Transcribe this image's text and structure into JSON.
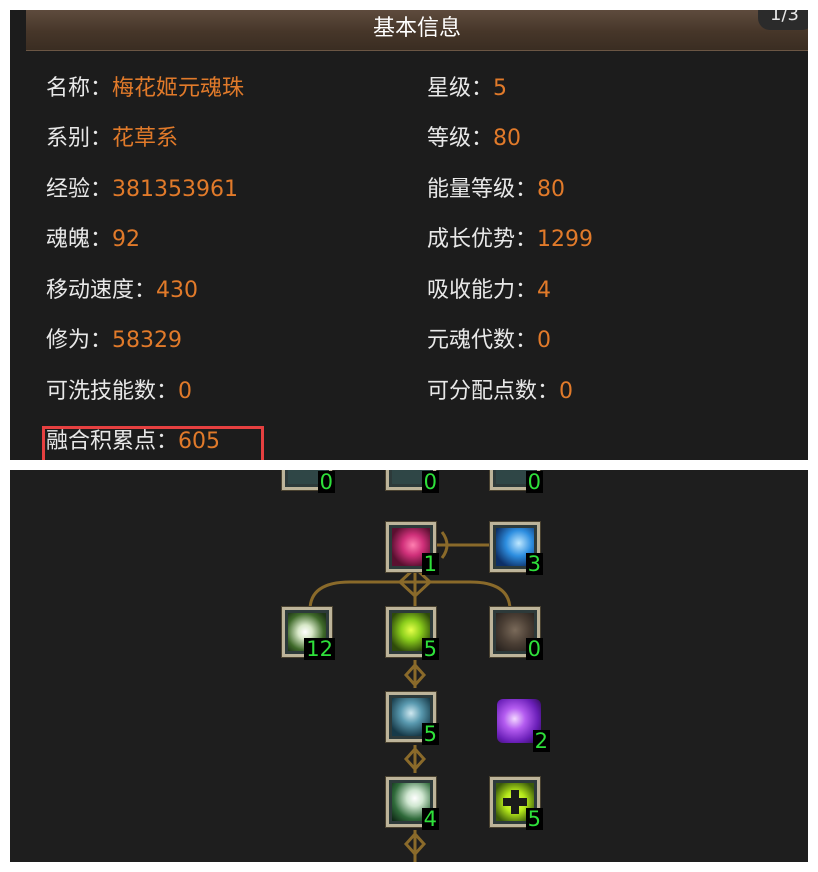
{
  "header": {
    "title": "基本信息",
    "page_indicator": "1/3"
  },
  "info": {
    "left": [
      {
        "label": "名称：",
        "value": "梅花姬元魂珠"
      },
      {
        "label": "系别：",
        "value": "花草系"
      },
      {
        "label": "经验：",
        "value": "381353961"
      },
      {
        "label": "魂魄：",
        "value": "92"
      },
      {
        "label": "移动速度：",
        "value": "430"
      },
      {
        "label": "修为：",
        "value": "58329"
      },
      {
        "label": "可洗技能数：",
        "value": "0"
      },
      {
        "label": "融合积累点：",
        "value": "605"
      }
    ],
    "right": [
      {
        "label": "星级：",
        "value": "5"
      },
      {
        "label": "等级：",
        "value": "80"
      },
      {
        "label": "能量等级：",
        "value": "80"
      },
      {
        "label": "成长优势：",
        "value": "1299"
      },
      {
        "label": "吸收能力：",
        "value": "4"
      },
      {
        "label": "元魂代数：",
        "value": "0"
      },
      {
        "label": "可分配点数：",
        "value": "0"
      }
    ]
  },
  "talents": {
    "top_row": [
      {
        "count": "0",
        "icon": "dim-skill-icon"
      },
      {
        "count": "0",
        "icon": "dim-skill-icon"
      },
      {
        "count": "0",
        "icon": "dim-skill-icon"
      }
    ],
    "row1": [
      {
        "count": "1",
        "icon": "pink-petal-skill-icon"
      },
      {
        "count": "3",
        "icon": "blue-wave-skill-icon"
      }
    ],
    "row2": [
      {
        "count": "12",
        "icon": "white-flower-skill-icon"
      },
      {
        "count": "5",
        "icon": "green-swirl-skill-icon"
      },
      {
        "count": "0",
        "icon": "stone-armor-skill-icon"
      }
    ],
    "row3": [
      {
        "count": "5",
        "icon": "spirit-figure-skill-icon"
      },
      {
        "count": "2",
        "icon": "purple-orb-skill-icon"
      }
    ],
    "row4": [
      {
        "count": "4",
        "icon": "white-lily-skill-icon"
      },
      {
        "count": "5",
        "icon": "green-cross-skill-icon"
      }
    ]
  },
  "colors": {
    "value_orange": "#e17a2a",
    "count_green": "#2ee03a",
    "highlight_red": "#e64040",
    "ornament_gold": "#8a6a2a"
  }
}
